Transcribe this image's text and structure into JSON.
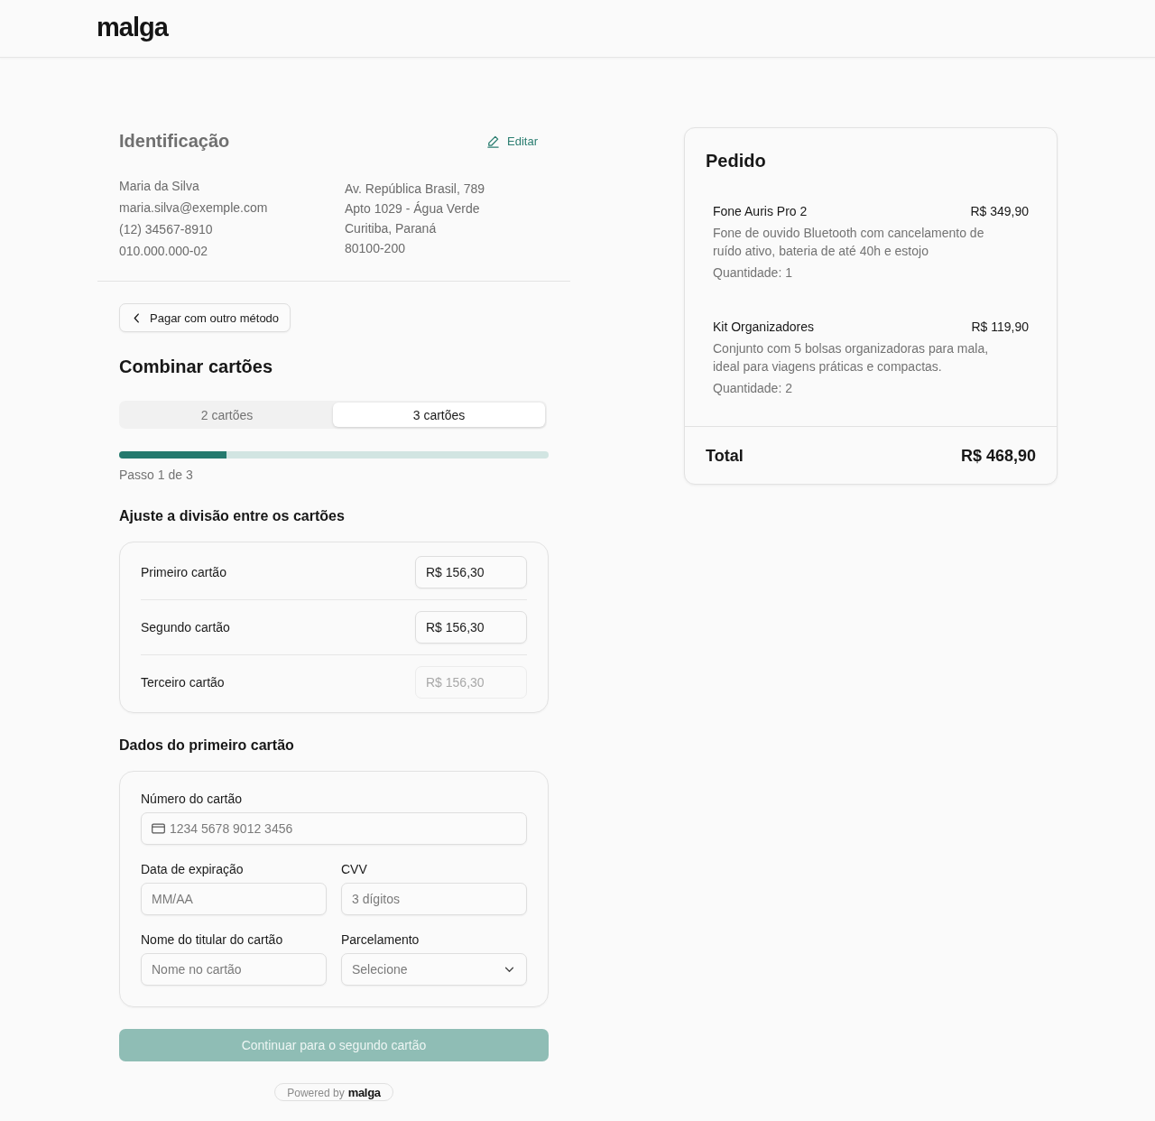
{
  "header": {
    "logo": "malga"
  },
  "identification": {
    "title": "Identificação",
    "edit_link": "Editar",
    "contact_lines": [
      "Maria da Silva",
      "maria.silva@exemple.com",
      "(12) 34567-8910",
      "010.000.000-02"
    ],
    "address_lines": [
      "Av. República Brasil, 789",
      "Apto 1029 - Água Verde",
      "Curitiba, Paraná",
      "80100-200"
    ]
  },
  "back_button": {
    "label": "Pagar com outro método"
  },
  "combine": {
    "title": "Combinar cartões",
    "tabs": [
      {
        "label": "2 cartões",
        "selected": false
      },
      {
        "label": "3 cartões",
        "selected": true
      }
    ],
    "progress": {
      "level": 0.25,
      "caption": "Passo 1 de 3"
    }
  },
  "split": {
    "title": "Ajuste a divisão entre os cartões",
    "rows": [
      {
        "label": "Primeiro cartão",
        "value": "R$ 156,30",
        "disabled": false
      },
      {
        "label": "Segundo cartão",
        "value": "R$ 156,30",
        "disabled": false
      },
      {
        "label": "Terceiro cartão",
        "value": "R$ 156,30",
        "disabled": true
      }
    ]
  },
  "card_form": {
    "title": "Dados do primeiro cartão",
    "fields": [
      {
        "kind": "card_number",
        "label": "Número do cartão",
        "placeholder": "1234 5678 9012 3456"
      },
      {
        "kind": "text",
        "label": "Data de expiração",
        "placeholder": "MM/AA"
      },
      {
        "kind": "text",
        "label": "CVV",
        "placeholder": "3 dígitos"
      },
      {
        "kind": "text",
        "label": "Nome do titular do cartão",
        "placeholder": "Nome no cartão"
      },
      {
        "kind": "select",
        "label": "Parcelamento",
        "placeholder": "Selecione"
      }
    ]
  },
  "continue_button": {
    "label": "Continuar para o segundo cartão",
    "disabled": true
  },
  "powered_by": {
    "text": "Powered by",
    "brand": "malga"
  },
  "order": {
    "title": "Pedido",
    "items": [
      {
        "name": "Fone Auris Pro 2",
        "price": "R$ 349,90",
        "description": "Fone de ouvido Bluetooth com cancelamento de ruído ativo, bateria de até 40h e estojo",
        "quantity": "Quantidade: 1"
      },
      {
        "name": "Kit Organizadores",
        "price": "R$ 119,90",
        "description": "Conjunto com 5 bolsas organizadoras para mala, ideal para viagens práticas e compactas.",
        "quantity": "Quantidade: 2"
      }
    ],
    "total": {
      "label": "Total",
      "value": "R$ 468,90"
    }
  }
}
